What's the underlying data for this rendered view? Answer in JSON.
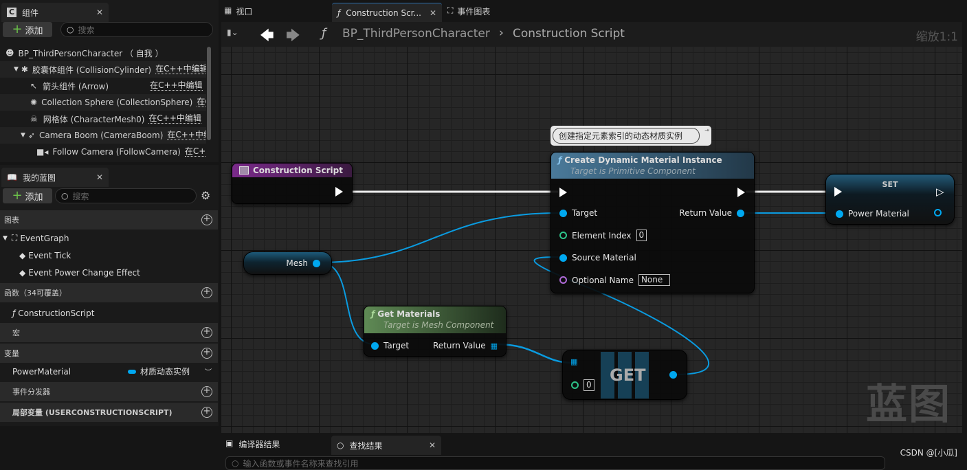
{
  "components_panel": {
    "tab": "组件",
    "add": "添加",
    "search_placeholder": "搜索",
    "tree": [
      {
        "name": "BP_ThirdPersonCharacter （ 自我 ）",
        "icon": "character-icon"
      },
      {
        "name": "胶囊体组件 (CollisionCylinder)",
        "edit": "在C++中编辑",
        "icon": "capsule-icon"
      },
      {
        "name": "箭头组件 (Arrow)",
        "edit": "在C++中编辑",
        "icon": "arrow-icon"
      },
      {
        "name": "Collection Sphere (CollectionSphere)",
        "edit": "在C++中编辑",
        "icon": "sphere-icon"
      },
      {
        "name": "网格体 (CharacterMesh0)",
        "edit": "在C++中编辑",
        "icon": "skeleton-icon"
      },
      {
        "name": "Camera Boom (CameraBoom)",
        "edit": "在C++中编辑",
        "icon": "spring-arm-icon"
      },
      {
        "name": "Follow Camera (FollowCamera)",
        "edit": "在C++中编辑",
        "icon": "camera-icon"
      }
    ]
  },
  "myblueprint_panel": {
    "tab": "我的蓝图",
    "add": "添加",
    "search_placeholder": "搜索",
    "graphs_section": "图表",
    "event_graph": "EventGraph",
    "events": [
      "Event Tick",
      "Event Power Change Effect"
    ],
    "functions_section": "函数（34可覆盖）",
    "function_item": "ConstructionScript",
    "macros_section": "宏",
    "variables_section": "变量",
    "variable": {
      "name": "PowerMaterial",
      "type": "材质动态实例",
      "type_color": "#00a8f0"
    },
    "dispatchers_section": "事件分发器",
    "locals_section": "局部变量 (USERCONSTRUCTIONSCRIPT)"
  },
  "editor_tabs": [
    {
      "label": "视口"
    },
    {
      "label": "Construction Scr..."
    },
    {
      "label": "事件图表"
    }
  ],
  "breadcrumb": {
    "root": "BP_ThirdPersonCharacter",
    "current": "Construction Script"
  },
  "zoom": "缩放1:1",
  "watermark": "蓝图",
  "nodes": {
    "construction_script": {
      "title": "Construction Script"
    },
    "mesh": {
      "label": "Mesh"
    },
    "get_materials": {
      "title": "Get Materials",
      "subtitle": "Target is Mesh Component",
      "target": "Target",
      "return": "Return Value"
    },
    "comment": "创建指定元素索引的动态材质实例",
    "cdmi": {
      "title": "Create Dynamic Material Instance",
      "subtitle": "Target is Primitive Component",
      "target": "Target",
      "return": "Return Value",
      "element_index": "Element Index",
      "element_index_value": "0",
      "source_material": "Source Material",
      "optional_name": "Optional Name",
      "optional_name_value": "None"
    },
    "set": {
      "title": "SET",
      "pin": "Power Material"
    },
    "get": {
      "title": "GET",
      "index": "0"
    }
  },
  "bottom_tabs": [
    {
      "label": "编译器结果"
    },
    {
      "label": "查找结果"
    }
  ],
  "find_placeholder": "输入函数或事件名称来查找引用",
  "credit": "CSDN @[小瓜]"
}
